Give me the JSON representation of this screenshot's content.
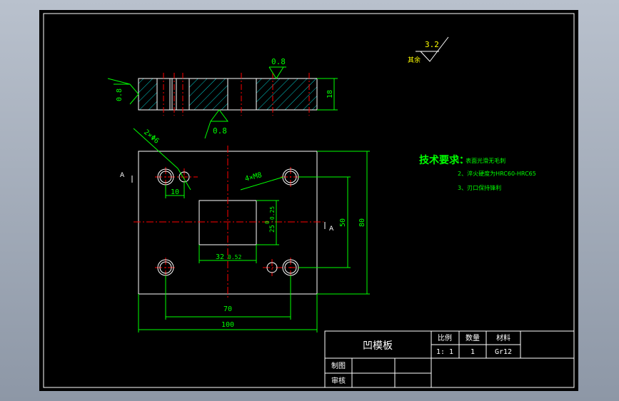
{
  "surface_finish": {
    "rest_value": "3.2",
    "rest_label": "其余",
    "top_value": "0.8",
    "left_value": "0.8",
    "bottom_value": "0.8"
  },
  "side_view": {
    "thickness": "18"
  },
  "plan_view": {
    "hole_callout_2": "2×Φ6",
    "hole_callout_4": "4×M8",
    "section_mark": "A",
    "dim_10": "10",
    "dim_50": "50",
    "dim_80": "80",
    "dim_70": "70",
    "dim_100": "100",
    "dim_32": "32",
    "dim_32_tol": "0.52",
    "dim_25": "25",
    "dim_25_tol_upper": "0",
    "dim_25_tol_lower": "-0.25"
  },
  "tech_requirements": {
    "title": "技术要求：",
    "item1": "1、表面光滑无毛刺",
    "item2": "2、淬火硬度为HRC60-HRC65",
    "item3": "3、刃口保持锋利"
  },
  "title_block": {
    "part_name": "凹模板",
    "scale_header": "比例",
    "qty_header": "数量",
    "material_header": "材料",
    "scale_value": "1: 1",
    "qty_value": "1",
    "material_value": "Gr12",
    "drawn_label": "制图",
    "checked_label": "审核"
  },
  "colors": {
    "background": "#000000",
    "outline": "#ffffff",
    "dimension": "#00ff00",
    "center_line": "#ff0000",
    "hatch": "#00cccc",
    "text_yellow": "#ffff00"
  }
}
